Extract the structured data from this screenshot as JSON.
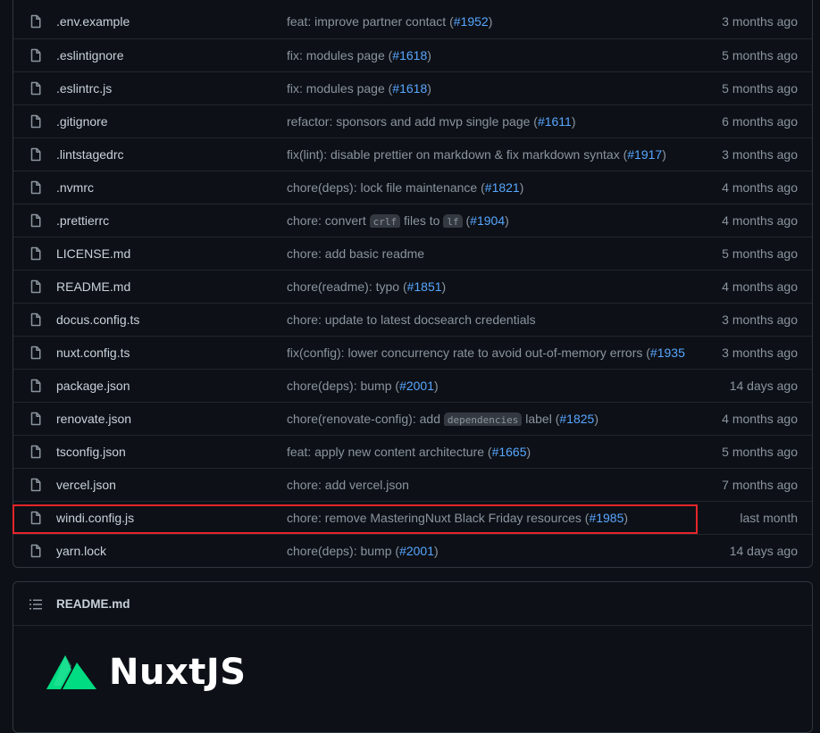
{
  "files": [
    {
      "name": ".env.example",
      "commit_text": "feat: improve partner contact (",
      "pr": "#1952",
      "commit_tail": ")",
      "age": "3 months ago"
    },
    {
      "name": ".eslintignore",
      "commit_text": "fix: modules page (",
      "pr": "#1618",
      "commit_tail": ")",
      "age": "5 months ago"
    },
    {
      "name": ".eslintrc.js",
      "commit_text": "fix: modules page (",
      "pr": "#1618",
      "commit_tail": ")",
      "age": "5 months ago"
    },
    {
      "name": ".gitignore",
      "commit_text": "refactor: sponsors and add mvp single page (",
      "pr": "#1611",
      "commit_tail": ")",
      "age": "6 months ago"
    },
    {
      "name": ".lintstagedrc",
      "commit_text": "fix(lint): disable prettier on markdown & fix markdown syntax (",
      "pr": "#1917",
      "commit_tail": ")",
      "age": "3 months ago"
    },
    {
      "name": ".nvmrc",
      "commit_text": "chore(deps): lock file maintenance (",
      "pr": "#1821",
      "commit_tail": ")",
      "age": "4 months ago"
    },
    {
      "name": ".prettierrc",
      "commit_parts": [
        "chore: convert ",
        "crlf",
        " files to ",
        "lf",
        " ("
      ],
      "pr": "#1904",
      "commit_tail": ")",
      "age": "4 months ago"
    },
    {
      "name": "LICENSE.md",
      "commit_text": "chore: add basic readme",
      "pr": "",
      "commit_tail": "",
      "age": "5 months ago"
    },
    {
      "name": "README.md",
      "commit_text": "chore(readme): typo (",
      "pr": "#1851",
      "commit_tail": ")",
      "age": "4 months ago"
    },
    {
      "name": "docus.config.ts",
      "commit_text": "chore: update to latest docsearch credentials",
      "pr": "",
      "commit_tail": "",
      "age": "3 months ago"
    },
    {
      "name": "nuxt.config.ts",
      "commit_text": "fix(config): lower concurrency rate to avoid out-of-memory errors (",
      "pr": "#1935",
      "commit_tail": "",
      "age": "3 months ago"
    },
    {
      "name": "package.json",
      "commit_text": "chore(deps): bump (",
      "pr": "#2001",
      "commit_tail": ")",
      "age": "14 days ago"
    },
    {
      "name": "renovate.json",
      "commit_parts": [
        "chore(renovate-config): add ",
        "dependencies",
        " label ("
      ],
      "pr": "#1825",
      "commit_tail": ")",
      "age": "4 months ago"
    },
    {
      "name": "tsconfig.json",
      "commit_text": "feat: apply new content architecture (",
      "pr": "#1665",
      "commit_tail": ")",
      "age": "5 months ago"
    },
    {
      "name": "vercel.json",
      "commit_text": "chore: add vercel.json",
      "pr": "",
      "commit_tail": "",
      "age": "7 months ago"
    },
    {
      "name": "windi.config.js",
      "commit_text": "chore: remove MasteringNuxt Black Friday resources (",
      "pr": "#1985",
      "commit_tail": ")",
      "age": "last month"
    },
    {
      "name": "yarn.lock",
      "commit_text": "chore(deps): bump (",
      "pr": "#2001",
      "commit_tail": ")",
      "age": "14 days ago"
    }
  ],
  "highlight_colour": "#e5252a",
  "readme": {
    "title": "README.md",
    "logo_text": "NuxtJS",
    "logo_colour": "#00dc82"
  }
}
